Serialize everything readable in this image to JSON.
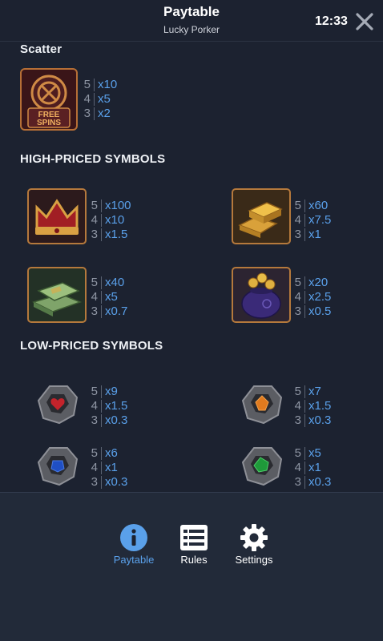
{
  "header": {
    "title": "Paytable",
    "subtitle": "Lucky Porker",
    "time": "12:33"
  },
  "colors": {
    "background": "#1c2230",
    "accent": "#5aa0ea",
    "footer": "#222a39"
  },
  "scatter": {
    "title": "Scatter",
    "badge_lines": [
      "FREE",
      "SPINS"
    ],
    "payouts": [
      {
        "count": "5",
        "mult": "x10"
      },
      {
        "count": "4",
        "mult": "x5"
      },
      {
        "count": "3",
        "mult": "x2"
      }
    ]
  },
  "high": {
    "title": "HIGH-PRICED SYMBOLS",
    "symbols": [
      {
        "icon": "crown-icon",
        "payouts": [
          {
            "count": "5",
            "mult": "x100"
          },
          {
            "count": "4",
            "mult": "x10"
          },
          {
            "count": "3",
            "mult": "x1.5"
          }
        ]
      },
      {
        "icon": "gold-bars-icon",
        "payouts": [
          {
            "count": "5",
            "mult": "x60"
          },
          {
            "count": "4",
            "mult": "x7.5"
          },
          {
            "count": "3",
            "mult": "x1"
          }
        ]
      },
      {
        "icon": "cash-stack-icon",
        "payouts": [
          {
            "count": "5",
            "mult": "x40"
          },
          {
            "count": "4",
            "mult": "x5"
          },
          {
            "count": "3",
            "mult": "x0.7"
          }
        ]
      },
      {
        "icon": "coin-purse-icon",
        "payouts": [
          {
            "count": "5",
            "mult": "x20"
          },
          {
            "count": "4",
            "mult": "x2.5"
          },
          {
            "count": "3",
            "mult": "x0.5"
          }
        ]
      }
    ]
  },
  "low": {
    "title": "LOW-PRICED SYMBOLS",
    "symbols": [
      {
        "icon": "red-gem-icon",
        "payouts": [
          {
            "count": "5",
            "mult": "x9"
          },
          {
            "count": "4",
            "mult": "x1.5"
          },
          {
            "count": "3",
            "mult": "x0.3"
          }
        ]
      },
      {
        "icon": "orange-gem-icon",
        "payouts": [
          {
            "count": "5",
            "mult": "x7"
          },
          {
            "count": "4",
            "mult": "x1.5"
          },
          {
            "count": "3",
            "mult": "x0.3"
          }
        ]
      },
      {
        "icon": "blue-gem-icon",
        "payouts": [
          {
            "count": "5",
            "mult": "x6"
          },
          {
            "count": "4",
            "mult": "x1"
          },
          {
            "count": "3",
            "mult": "x0.3"
          }
        ]
      },
      {
        "icon": "green-gem-icon",
        "payouts": [
          {
            "count": "5",
            "mult": "x5"
          },
          {
            "count": "4",
            "mult": "x1"
          },
          {
            "count": "3",
            "mult": "x0.3"
          }
        ]
      }
    ]
  },
  "nav": {
    "paytable": "Paytable",
    "rules": "Rules",
    "settings": "Settings",
    "active": "paytable"
  }
}
